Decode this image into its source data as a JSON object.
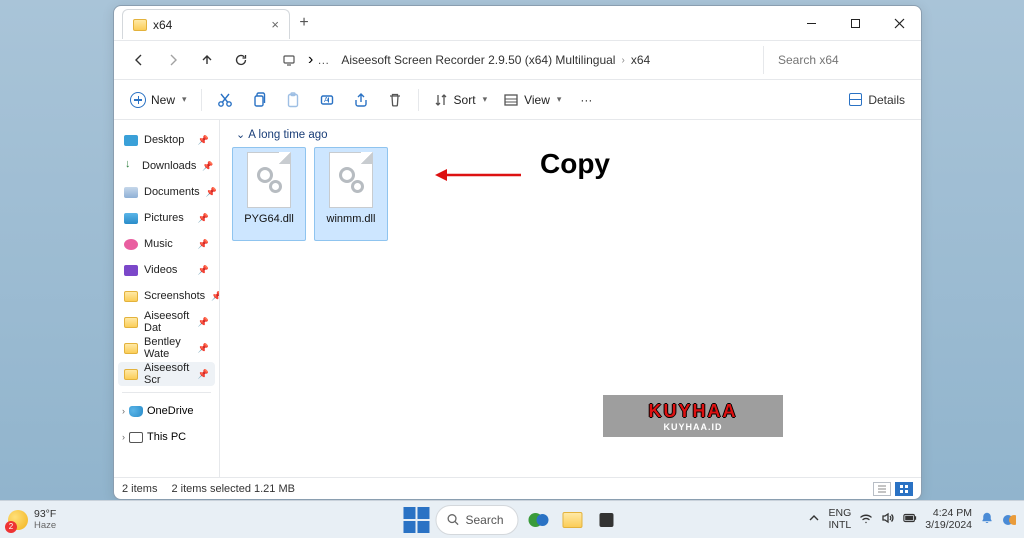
{
  "window": {
    "tab_title": "x64",
    "breadcrumb_parent": "Aiseesoft Screen Recorder 2.9.50 (x64) Multilingual",
    "breadcrumb_current": "x64",
    "search_placeholder": "Search x64"
  },
  "toolbar": {
    "new_label": "New",
    "sort_label": "Sort",
    "view_label": "View",
    "details_label": "Details"
  },
  "sidebar": {
    "items": [
      {
        "label": "Desktop",
        "icon": "desktop"
      },
      {
        "label": "Downloads",
        "icon": "downloads"
      },
      {
        "label": "Documents",
        "icon": "docs"
      },
      {
        "label": "Pictures",
        "icon": "pics"
      },
      {
        "label": "Music",
        "icon": "music"
      },
      {
        "label": "Videos",
        "icon": "videos"
      },
      {
        "label": "Screenshots",
        "icon": "folder"
      },
      {
        "label": "Aiseesoft Dat",
        "icon": "folder"
      },
      {
        "label": "Bentley Wate",
        "icon": "folder"
      },
      {
        "label": "Aiseesoft Scr",
        "icon": "folder"
      }
    ],
    "tree": [
      {
        "label": "OneDrive",
        "icon": "onedrive"
      },
      {
        "label": "This PC",
        "icon": "thispc"
      }
    ]
  },
  "content": {
    "group_header": "A long time ago",
    "files": [
      {
        "name": "PYG64.dll"
      },
      {
        "name": "winmm.dll"
      }
    ]
  },
  "annotation": {
    "text": "Copy"
  },
  "watermark": {
    "line1": "KUYHAA",
    "line2": "KUYHAA.ID"
  },
  "status": {
    "count": "2 items",
    "selection": "2 items selected  1.21 MB"
  },
  "taskbar": {
    "weather_temp": "93°F",
    "weather_desc": "Haze",
    "weather_badge": "2",
    "search_label": "Search",
    "lang1": "ENG",
    "lang2": "INTL",
    "time": "4:24 PM",
    "date": "3/19/2024"
  }
}
